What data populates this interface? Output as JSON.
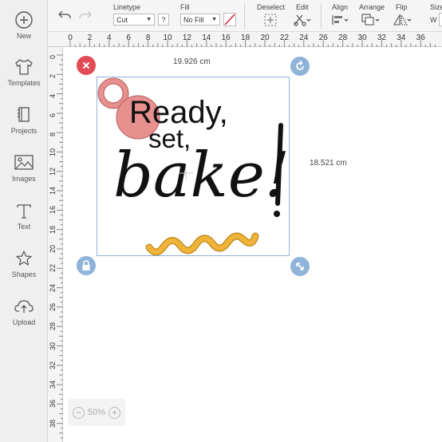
{
  "sidebar": {
    "items": [
      {
        "label": "New",
        "icon": "plus-circle-icon"
      },
      {
        "label": "Templates",
        "icon": "tshirt-icon"
      },
      {
        "label": "Projects",
        "icon": "projects-book-icon"
      },
      {
        "label": "Images",
        "icon": "image-icon"
      },
      {
        "label": "Text",
        "icon": "text-t-icon"
      },
      {
        "label": "Shapes",
        "icon": "shapes-icon"
      },
      {
        "label": "Upload",
        "icon": "upload-cloud-icon"
      }
    ]
  },
  "toolbar": {
    "undo_icon": "undo-icon",
    "redo_icon": "redo-icon",
    "linetype_label": "Linetype",
    "linetype_value": "Cut",
    "help_label": "?",
    "fill_label": "Fill",
    "fill_value": "No Fill",
    "deselect_label": "Deselect",
    "edit_label": "Edit",
    "align_label": "Align",
    "arrange_label": "Arrange",
    "flip_label": "Flip",
    "size_label": "Size",
    "size_w": "W"
  },
  "ruler": {
    "horizontal": [
      "0",
      "2",
      "4",
      "6",
      "8",
      "10",
      "12",
      "14",
      "16",
      "18",
      "20",
      "22",
      "24",
      "26",
      "28",
      "30",
      "32",
      "34",
      "36"
    ],
    "vertical": [
      "0",
      "2",
      "4",
      "6",
      "8",
      "10",
      "12",
      "14",
      "16",
      "18",
      "20",
      "22",
      "24",
      "26",
      "28",
      "30",
      "32",
      "34",
      "36",
      "38"
    ]
  },
  "canvas": {
    "width_label": "19.926 cm",
    "height_label": "18.521 cm",
    "design_text": [
      "Ready,",
      "set,",
      "bake!"
    ]
  },
  "zoom": {
    "level": "50%",
    "minus": "−",
    "plus": "+"
  },
  "colors": {
    "delete_handle": "#e24a56",
    "handle_blue": "#8fb3d9",
    "selection_border": "#8fb3d9",
    "pink": "#e8908e",
    "squiggle": "#f0b43a"
  }
}
